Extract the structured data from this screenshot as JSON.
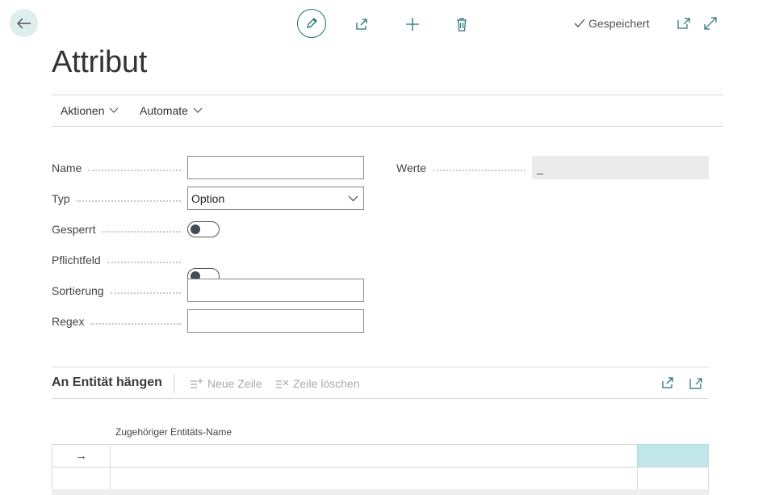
{
  "toolbar": {
    "saved_label": "Gespeichert"
  },
  "page": {
    "title": "Attribut"
  },
  "menu": {
    "actions_label": "Aktionen",
    "automate_label": "Automate"
  },
  "form": {
    "name_label": "Name",
    "name_value": "",
    "typ_label": "Typ",
    "typ_value": "Option",
    "gesperrt_label": "Gesperrt",
    "gesperrt_on": false,
    "pflichtfeld_label": "Pflichtfeld",
    "pflichtfeld_on": false,
    "sortierung_label": "Sortierung",
    "sortierung_value": "",
    "regex_label": "Regex",
    "regex_value": "",
    "werte_label": "Werte",
    "werte_value": "_"
  },
  "subpage": {
    "title": "An Entität hängen",
    "new_row_label": "Neue Zeile",
    "delete_row_label": "Zeile löschen",
    "column_header": "Zugehöriger Entitäts-Name",
    "rows": [
      {
        "marker": "→",
        "value": ""
      },
      {
        "marker": "",
        "value": ""
      }
    ]
  },
  "colors": {
    "accent": "#1f6f79",
    "selected_cell": "#c0e6ea",
    "back_bg": "#dcefee"
  }
}
